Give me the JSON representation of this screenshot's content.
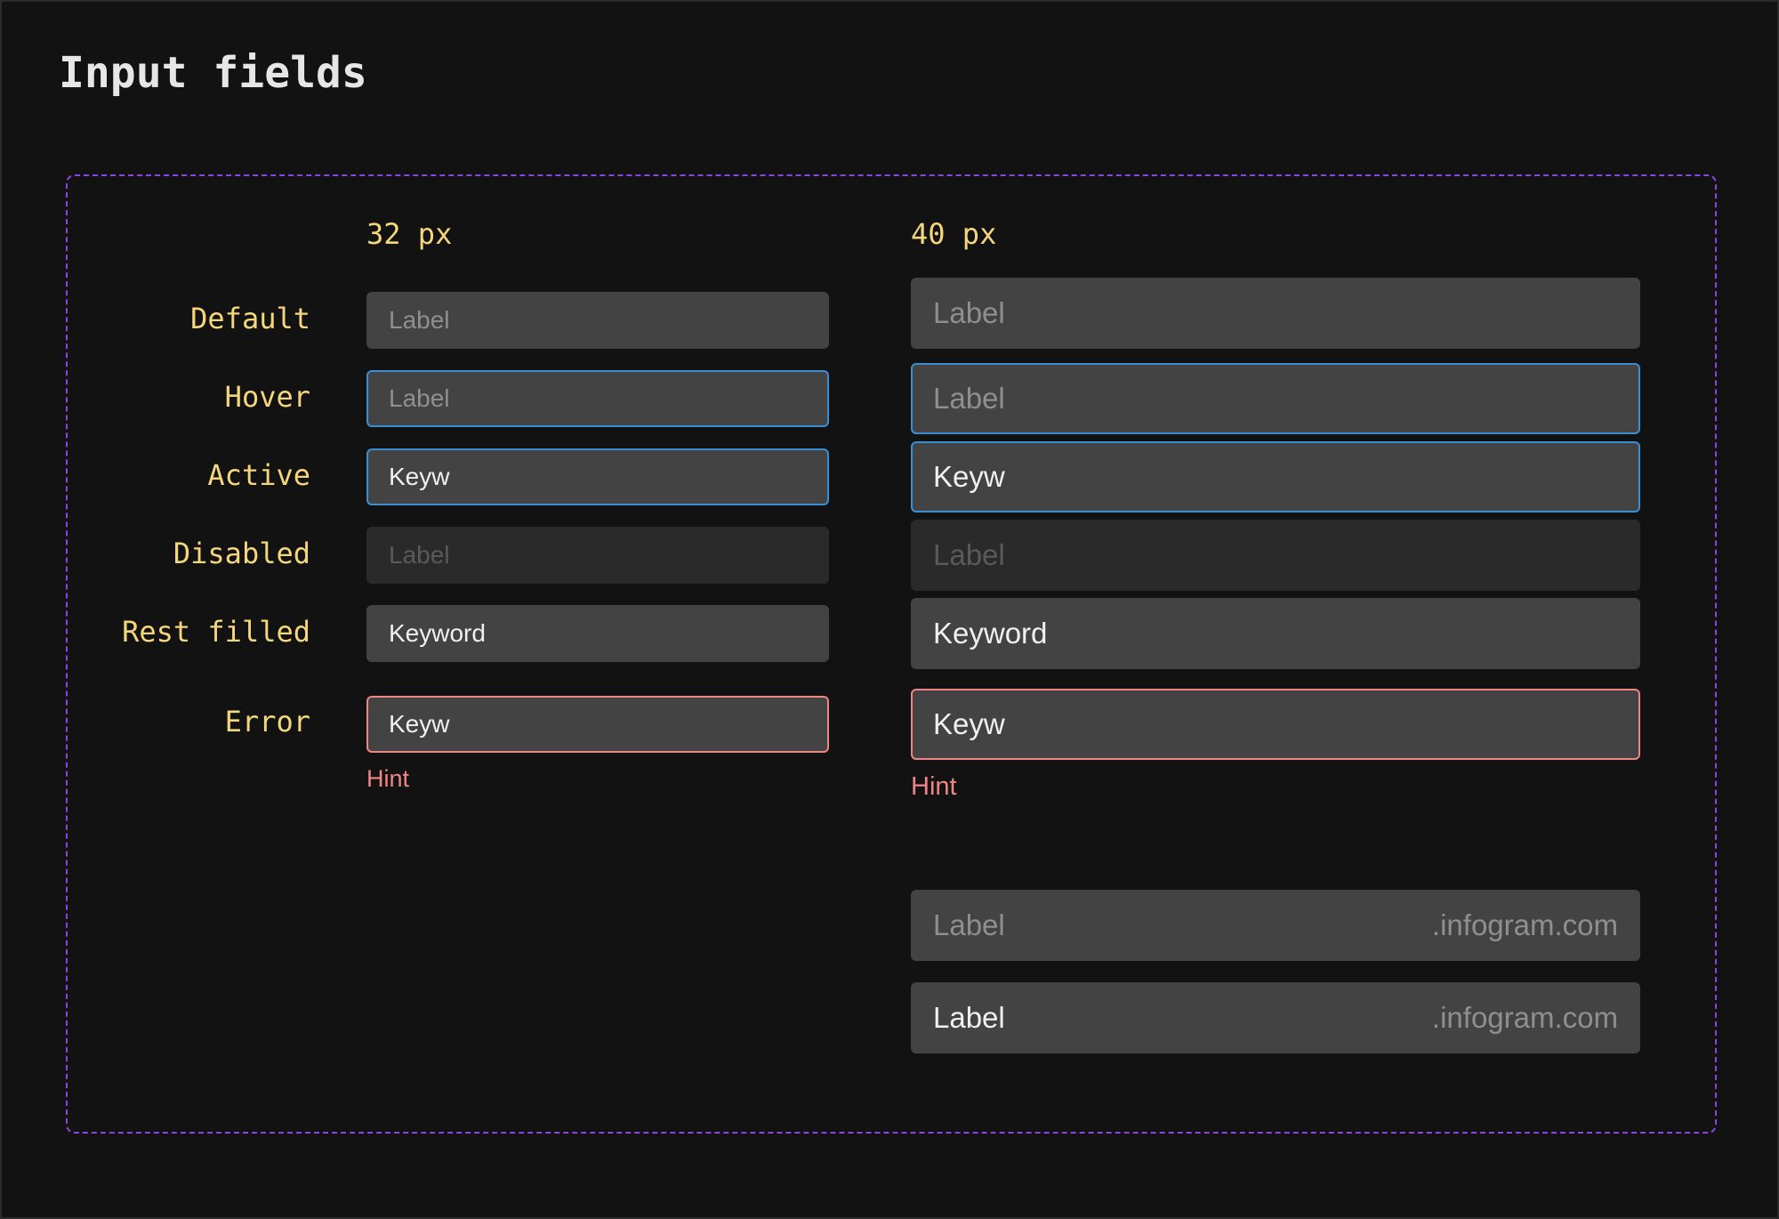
{
  "page": {
    "title": "Input fields"
  },
  "columns": {
    "small": "32 px",
    "large": "40 px"
  },
  "states": {
    "default": "Default",
    "hover": "Hover",
    "active": "Active",
    "disabled": "Disabled",
    "rest_filled": "Rest filled",
    "error": "Error"
  },
  "fields": {
    "default": "Label",
    "hover": "Label",
    "active": "Keyw",
    "disabled": "Label",
    "rest_filled": "Keyword",
    "error": "Keyw",
    "hint": "Hint"
  },
  "suffix_fields": [
    {
      "value": "Label",
      "suffix": ".infogram.com"
    },
    {
      "value": "Label",
      "suffix": ".infogram.com"
    }
  ],
  "colors": {
    "background": "#121212",
    "field_bg": "#434343",
    "disabled_bg": "#2a2a2a",
    "focus_border": "#3c8ed2",
    "error": "#f08585",
    "label_yellow": "#f5d77b",
    "frame_dashed": "#8b45e6"
  }
}
